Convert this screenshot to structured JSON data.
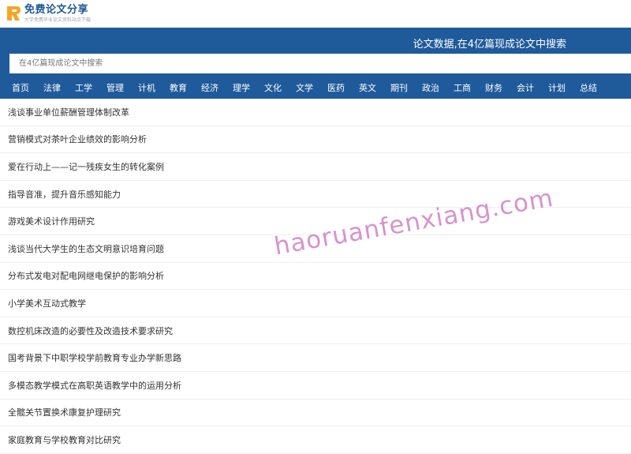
{
  "logo": {
    "title": "免费论文分享",
    "subtitle": "大学免费毕业论文资料站点下载"
  },
  "header": {
    "slogan": "论文数据,在4亿篇现成论文中搜索"
  },
  "search": {
    "placeholder": "在4亿篇现成论文中搜索"
  },
  "nav": {
    "items": [
      "首页",
      "法律",
      "工学",
      "管理",
      "计机",
      "教育",
      "经济",
      "理学",
      "文化",
      "文学",
      "医药",
      "英文",
      "期刊",
      "政治",
      "工商",
      "财务",
      "会计",
      "计划",
      "总结"
    ]
  },
  "articles": [
    "浅谈事业单位薪酬管理体制改革",
    "营销模式对茶叶企业绩效的影响分析",
    "爱在行动上——记一残疾女生的转化案例",
    "指导音准，提升音乐感知能力",
    "游戏美术设计作用研究",
    "浅谈当代大学生的生态文明意识培育问题",
    "分布式发电对配电网继电保护的影响分析",
    "小学美术互动式教学",
    "数控机床改造的必要性及改造技术要求研究",
    "国考背景下中职学校学前教育专业办学新思路",
    "多模态教学模式在高职英语教学中的运用分析",
    "全髋关节置换术康复护理研究",
    "家庭教育与学校教育对比研究"
  ],
  "watermark": "haoruanfenxiang.com",
  "colors": {
    "brand": "#1f5a9b",
    "logo_orange": "#f5a623",
    "watermark": "#d080c4"
  },
  "icons": {
    "logo": "logo-icon"
  }
}
